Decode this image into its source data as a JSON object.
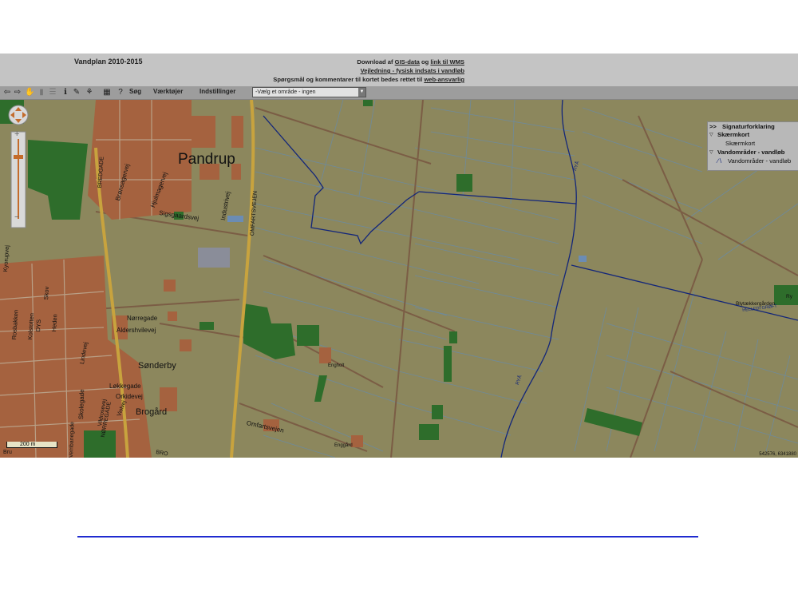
{
  "header": {
    "app_title": "Vandplan 2010-2015",
    "line1_prefix": "Download af ",
    "line1_link1": "GIS-data",
    "line1_mid": " og ",
    "line1_link2": "link til WMS",
    "line2_link": "Vejledning - fysisk indsats i vandløb",
    "line3_prefix": "Spørgsmål og kommentarer til kortet bedes rettet til ",
    "line3_link": "web-ansvarlig"
  },
  "toolbar": {
    "menu_search": "Søg",
    "menu_tools": "Værktøjer",
    "menu_settings": "Indstillinger",
    "select_area": "-Vælg et område - ingen",
    "help_label": "?"
  },
  "legend": {
    "toggle": ">>",
    "title": "Signaturforklaring",
    "group1": "Skærmkort",
    "group1_item": "Skærmkort",
    "group2": "Vandområder - vandløb",
    "group2_item": "Vandområder - vandløb"
  },
  "map": {
    "places": {
      "pandrup": "Pandrup",
      "sonderby": "Sønderby",
      "brogard": "Brogård",
      "engholt": "Engholt",
      "enggard": "Enggård",
      "blytaekkergaarden": "Blytækkergården",
      "ryvej_partial": "Ry"
    },
    "streets": {
      "bredgade": "BREDGADE",
      "bronsagervej": "Brønsagervej",
      "hjulmagervej": "Hjulmagervej",
      "industrivej": "Industrivej",
      "sigsgaardsvej": "Sigsgaardsvej",
      "omfartsvejen_v": "OMFARTSVEJEN",
      "kyorupvej": "Kyorupvej",
      "norregade": "Nørregade",
      "aldershvilevej": "Aldershvilevej",
      "orkidevej": "Orkidevej",
      "lokkegade": "Løkkegade",
      "omfartsvejen": "Omfartsvejen",
      "norregade_caps": "NØRREGADE",
      "skolegade": "Skolegade",
      "lindevej": "Lindevej",
      "vildrosevej": "Vildrosevej",
      "violvej": "Violvej",
      "skovvej": "Skov",
      "kolstotten": "Kolstotten",
      "dys": "DYS",
      "rosbakken": "Rosbakken",
      "heden": "Heden",
      "brogade_partial": "BRO",
      "vembanegade": "Vembanegade",
      "bru_partial": "Bru"
    },
    "streams": {
      "rya": "RYÅ",
      "rya2": "RYÅ",
      "helledi_groft": "HELLEDI GRØFT"
    },
    "scale_label": "200 m",
    "coords": "542576, 6341880"
  },
  "colors": {
    "map_bg": "#8c875d",
    "urban": "#a5623f",
    "green": "#2e6d2b",
    "stream": "#13267a",
    "road_yellow": "#c8a33e",
    "divider": "#1f2bd0"
  }
}
